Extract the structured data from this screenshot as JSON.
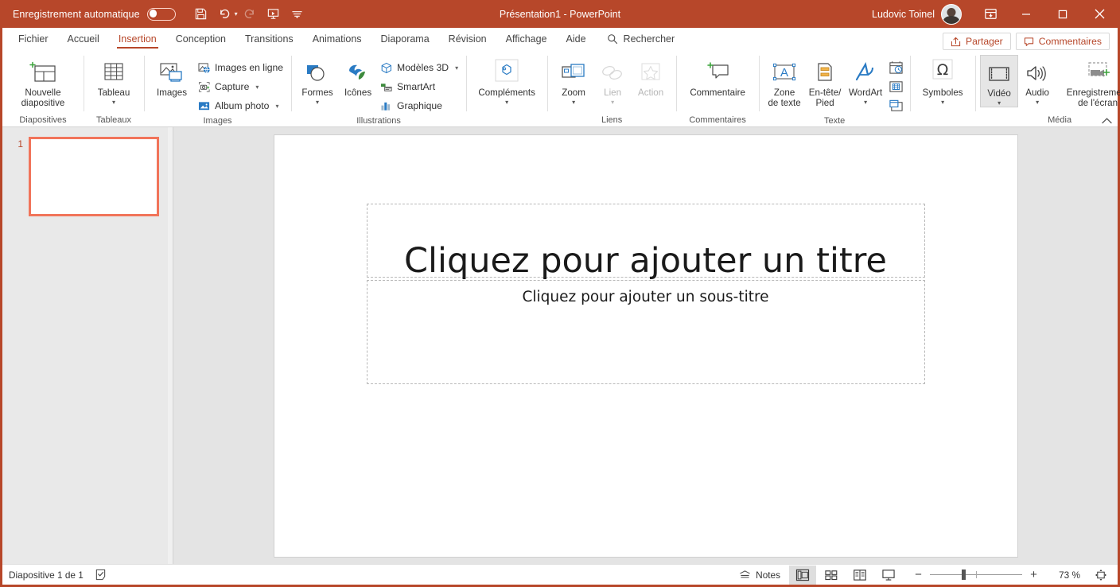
{
  "titlebar": {
    "autosave_label": "Enregistrement automatique",
    "autosave_state": "off",
    "qat": [
      {
        "name": "save",
        "label": "Enregistrer"
      },
      {
        "name": "undo",
        "label": "Annuler"
      },
      {
        "name": "redo",
        "label": "Rétablir",
        "disabled": true
      },
      {
        "name": "start-slideshow",
        "label": "Démarrer à partir du début"
      },
      {
        "name": "customize-qat",
        "label": "Personnaliser la barre d'outils Accès rapide"
      }
    ],
    "document_title": "Présentation1  -  PowerPoint",
    "user_name": "Ludovic Toinel",
    "ribbon_display_label": "Options d'affichage du ruban",
    "minimize_label": "Réduire",
    "maximize_label": "Agrandir",
    "close_label": "Fermer",
    "bg_color": "#B7472A"
  },
  "tabs": [
    {
      "label": "Fichier",
      "active": false
    },
    {
      "label": "Accueil",
      "active": false
    },
    {
      "label": "Insertion",
      "active": true
    },
    {
      "label": "Conception",
      "active": false
    },
    {
      "label": "Transitions",
      "active": false
    },
    {
      "label": "Animations",
      "active": false
    },
    {
      "label": "Diaporama",
      "active": false
    },
    {
      "label": "Révision",
      "active": false
    },
    {
      "label": "Affichage",
      "active": false
    },
    {
      "label": "Aide",
      "active": false
    }
  ],
  "search": {
    "placeholder": "Rechercher",
    "label": "Rechercher"
  },
  "tab_actions": {
    "share_label": "Partager",
    "comments_label": "Commentaires",
    "accent_color": "#B7472A"
  },
  "ribbon": {
    "collapse_label": "Réduire le ruban",
    "groups": [
      {
        "name": "diapositives",
        "label": "Diapositives",
        "big": [
          {
            "label": "Nouvelle\ndiapositive",
            "icon": "new-slide-icon",
            "caret": true,
            "selected": false,
            "disabled": false
          }
        ],
        "small": [],
        "icons": []
      },
      {
        "name": "tableaux",
        "label": "Tableaux",
        "big": [
          {
            "label": "Tableau",
            "icon": "table-icon",
            "caret": true,
            "selected": false,
            "disabled": false
          }
        ],
        "small": [],
        "icons": []
      },
      {
        "name": "images",
        "label": "Images",
        "big": [
          {
            "label": "Images",
            "icon": "pictures-icon",
            "caret": false,
            "selected": false,
            "disabled": false
          }
        ],
        "small": [
          {
            "label": "Images en ligne",
            "icon": "online-pictures-icon",
            "caret": false
          },
          {
            "label": "Capture",
            "icon": "screenshot-icon",
            "caret": true
          },
          {
            "label": "Album photo",
            "icon": "photo-album-icon",
            "caret": true
          }
        ],
        "icons": []
      },
      {
        "name": "illustrations",
        "label": "Illustrations",
        "big": [
          {
            "label": "Formes",
            "icon": "shapes-icon",
            "caret": true,
            "selected": false,
            "disabled": false
          },
          {
            "label": "Icônes",
            "icon": "icons-icon",
            "caret": false,
            "selected": false,
            "disabled": false
          }
        ],
        "small": [
          {
            "label": "Modèles 3D",
            "icon": "model-3d-icon",
            "caret": true
          },
          {
            "label": "SmartArt",
            "icon": "smartart-icon",
            "caret": false
          },
          {
            "label": "Graphique",
            "icon": "chart-icon",
            "caret": false
          }
        ],
        "icons": []
      },
      {
        "name": "complements",
        "label": "",
        "big": [
          {
            "label": "Compléments",
            "icon": "addins-icon",
            "caret": true,
            "selected": false,
            "disabled": false
          }
        ],
        "small": [],
        "icons": []
      },
      {
        "name": "liens",
        "label": "Liens",
        "big": [
          {
            "label": "Zoom",
            "icon": "zoom-icon",
            "caret": true,
            "selected": false,
            "disabled": false
          },
          {
            "label": "Lien",
            "icon": "link-icon",
            "caret": true,
            "selected": false,
            "disabled": true
          },
          {
            "label": "Action",
            "icon": "action-icon",
            "caret": false,
            "selected": false,
            "disabled": true
          }
        ],
        "small": [],
        "icons": []
      },
      {
        "name": "commentaires",
        "label": "Commentaires",
        "big": [
          {
            "label": "Commentaire",
            "icon": "new-comment-icon",
            "caret": false,
            "selected": false,
            "disabled": false
          }
        ],
        "small": [],
        "icons": []
      },
      {
        "name": "texte",
        "label": "Texte",
        "big": [
          {
            "label": "Zone\nde texte",
            "icon": "text-box-icon",
            "caret": false,
            "selected": false,
            "disabled": false
          },
          {
            "label": "En-tête/\nPied",
            "icon": "header-footer-icon",
            "caret": false,
            "selected": false,
            "disabled": false
          },
          {
            "label": "WordArt",
            "icon": "wordart-icon",
            "caret": true,
            "selected": false,
            "disabled": false
          }
        ],
        "small": [],
        "icons": [
          {
            "name": "date-time-icon",
            "label": "Date et heure"
          },
          {
            "name": "slide-number-icon",
            "label": "Numéro de diapositive"
          },
          {
            "name": "object-icon",
            "label": "Objet"
          }
        ]
      },
      {
        "name": "symboles",
        "label": "",
        "big": [
          {
            "label": "Symboles",
            "icon": "symbols-icon",
            "caret": true,
            "selected": false,
            "disabled": false
          }
        ],
        "small": [],
        "icons": []
      },
      {
        "name": "media",
        "label": "Média",
        "big": [
          {
            "label": "Vidéo",
            "icon": "video-icon",
            "caret": true,
            "selected": true,
            "disabled": false
          },
          {
            "label": "Audio",
            "icon": "audio-icon",
            "caret": true,
            "selected": false,
            "disabled": false
          },
          {
            "label": "Enregistrement\nde l'écran",
            "icon": "screen-recording-icon",
            "caret": false,
            "selected": false,
            "disabled": false
          }
        ],
        "small": [],
        "icons": []
      }
    ]
  },
  "thumbnails": {
    "slides": [
      {
        "number": "1",
        "selected": true
      }
    ],
    "selection_color": "#F1745A"
  },
  "slide": {
    "title_placeholder": "Cliquez pour ajouter un titre",
    "subtitle_placeholder": "Cliquez pour ajouter un sous-titre"
  },
  "statusbar": {
    "slide_counter": "Diapositive 1 de 1",
    "accessibility_label": "Vérificateur d'accessibilité",
    "notes_label": "Notes",
    "views": [
      {
        "name": "normal-view",
        "label": "Normal",
        "active": true
      },
      {
        "name": "slide-sorter-view",
        "label": "Trieuse de diapositives",
        "active": false
      },
      {
        "name": "reading-view",
        "label": "Mode Lecture",
        "active": false
      },
      {
        "name": "slideshow-view",
        "label": "Diaporama",
        "active": false
      }
    ],
    "zoom_out_label": "−",
    "zoom_in_label": "+",
    "zoom_level": "73 %",
    "fit_label": "Ajuster la diapositive à la fenêtre active"
  }
}
